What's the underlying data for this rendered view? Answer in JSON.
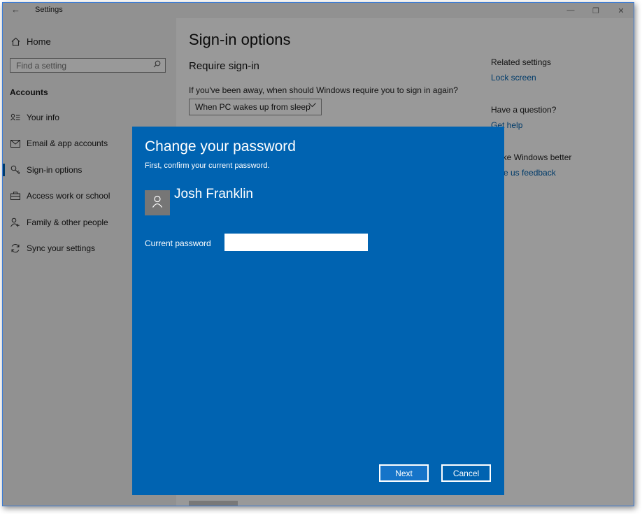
{
  "titlebar": {
    "app_title": "Settings",
    "back_icon": "back-arrow-icon",
    "minimize_glyph": "—",
    "restore_glyph": "❐",
    "close_glyph": "✕"
  },
  "sidebar": {
    "home_label": "Home",
    "search_placeholder": "Find a setting",
    "section_label": "Accounts",
    "items": [
      {
        "label": "Your info",
        "icon": "person-info-icon"
      },
      {
        "label": "Email & app accounts",
        "icon": "mail-icon"
      },
      {
        "label": "Sign-in options",
        "icon": "key-icon",
        "active": true
      },
      {
        "label": "Access work or school",
        "icon": "briefcase-icon"
      },
      {
        "label": "Family & other people",
        "icon": "add-person-icon"
      },
      {
        "label": "Sync your settings",
        "icon": "sync-icon"
      }
    ]
  },
  "main": {
    "page_title": "Sign-in options",
    "section_title": "Require sign-in",
    "question": "If you've been away, when should Windows require you to sign in again?",
    "dropdown_value": "When PC wakes up from sleep"
  },
  "related": {
    "heading": "Related settings",
    "link": "Lock screen",
    "question_heading": "Have a question?",
    "help_link": "Get help",
    "feedback_heading": "Make Windows better",
    "feedback_link": "Give us feedback"
  },
  "dialog": {
    "title": "Change your password",
    "subtitle": "First, confirm your current password.",
    "user_name": "Josh Franklin",
    "password_label": "Current password",
    "password_value": "",
    "next_label": "Next",
    "cancel_label": "Cancel"
  },
  "colors": {
    "accent": "#0063b1",
    "dialog_bg": "#0063b1",
    "window_border": "#3c7cd6"
  }
}
